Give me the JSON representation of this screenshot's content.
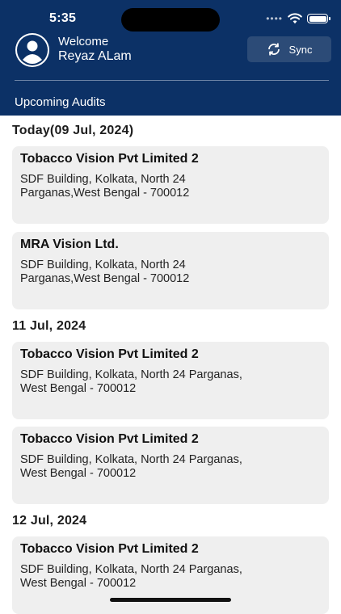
{
  "status_bar": {
    "time": "5:35"
  },
  "header": {
    "welcome": "Welcome",
    "user_name": "Reyaz ALam",
    "sync_label": "Sync",
    "section_title": "Upcoming Audits"
  },
  "groups": [
    {
      "date": "Today(09 Jul, 2024)",
      "audits": [
        {
          "name": "Tobacco Vision Pvt Limited 2",
          "address_line1": "SDF Building, Kolkata, North 24",
          "address_line2": "Parganas,West Bengal - 700012"
        },
        {
          "name": "MRA Vision Ltd.",
          "address_line1": "SDF Building, Kolkata, North 24",
          "address_line2": "Parganas,West Bengal - 700012"
        }
      ]
    },
    {
      "date": "11 Jul, 2024",
      "audits": [
        {
          "name": "Tobacco Vision Pvt Limited 2",
          "address_line1": "SDF Building, Kolkata, North 24 Parganas,",
          "address_line2": "West Bengal - 700012"
        },
        {
          "name": "Tobacco Vision Pvt Limited 2",
          "address_line1": "SDF Building, Kolkata, North 24 Parganas,",
          "address_line2": "West Bengal - 700012"
        }
      ]
    },
    {
      "date": "12 Jul, 2024",
      "audits": [
        {
          "name": "Tobacco Vision Pvt Limited 2",
          "address_line1": "SDF Building, Kolkata, North 24 Parganas,",
          "address_line2": "West Bengal - 700012"
        }
      ]
    }
  ],
  "colors": {
    "header_bg": "#0c3166",
    "sync_bg": "#2c4b77",
    "card_bg": "#efefef"
  },
  "icons": {
    "avatar": "person-icon",
    "sync": "sync-icon",
    "wifi": "wifi-icon",
    "battery": "battery-icon"
  }
}
